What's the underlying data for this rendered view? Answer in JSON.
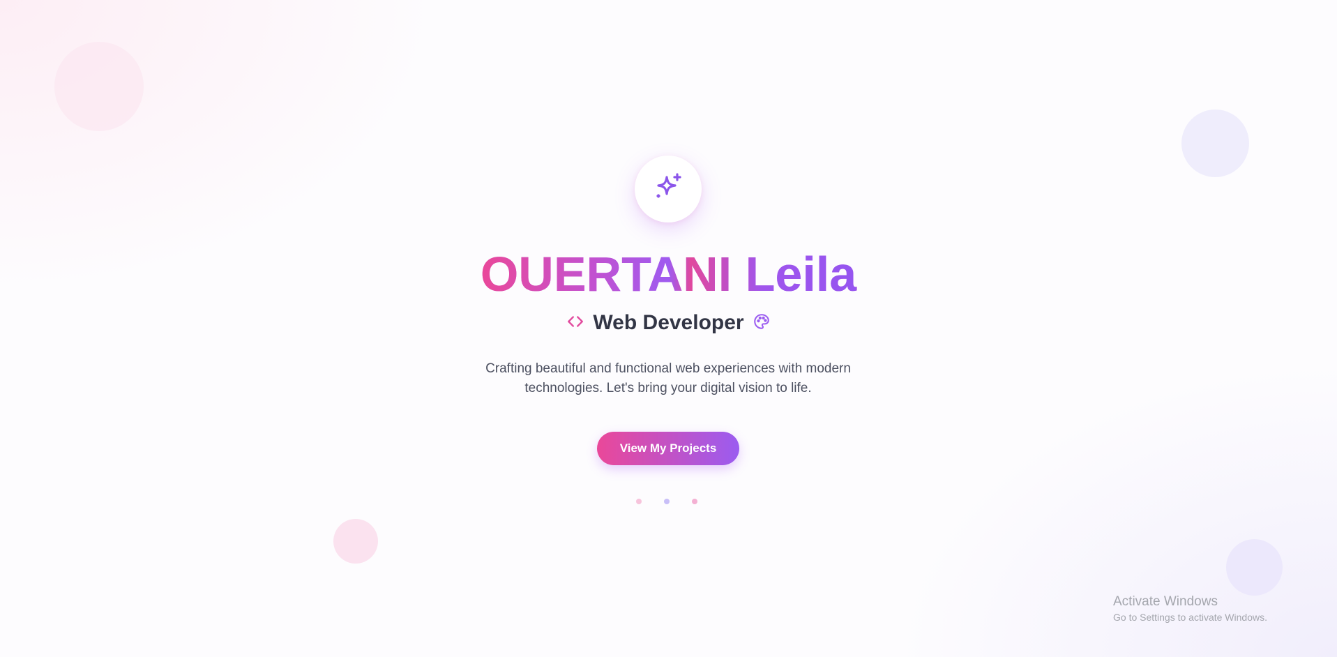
{
  "hero": {
    "name": "OUERTANI Leila",
    "role": "Web Developer",
    "description": "Crafting beautiful and functional web experiences with modern technologies. Let's bring your digital vision to life.",
    "cta_label": "View My Projects",
    "icons": {
      "badge": "sparkles-icon",
      "role_left": "code-icon",
      "role_right": "palette-icon"
    }
  },
  "carousel": {
    "dot_count": 3
  },
  "watermark": {
    "title": "Activate Windows",
    "subtitle": "Go to Settings to activate Windows."
  },
  "colors": {
    "accent_pink": "#ea4899",
    "accent_purple": "#9b5cf0",
    "text_dark": "#323545",
    "text_muted": "#4c5060"
  }
}
